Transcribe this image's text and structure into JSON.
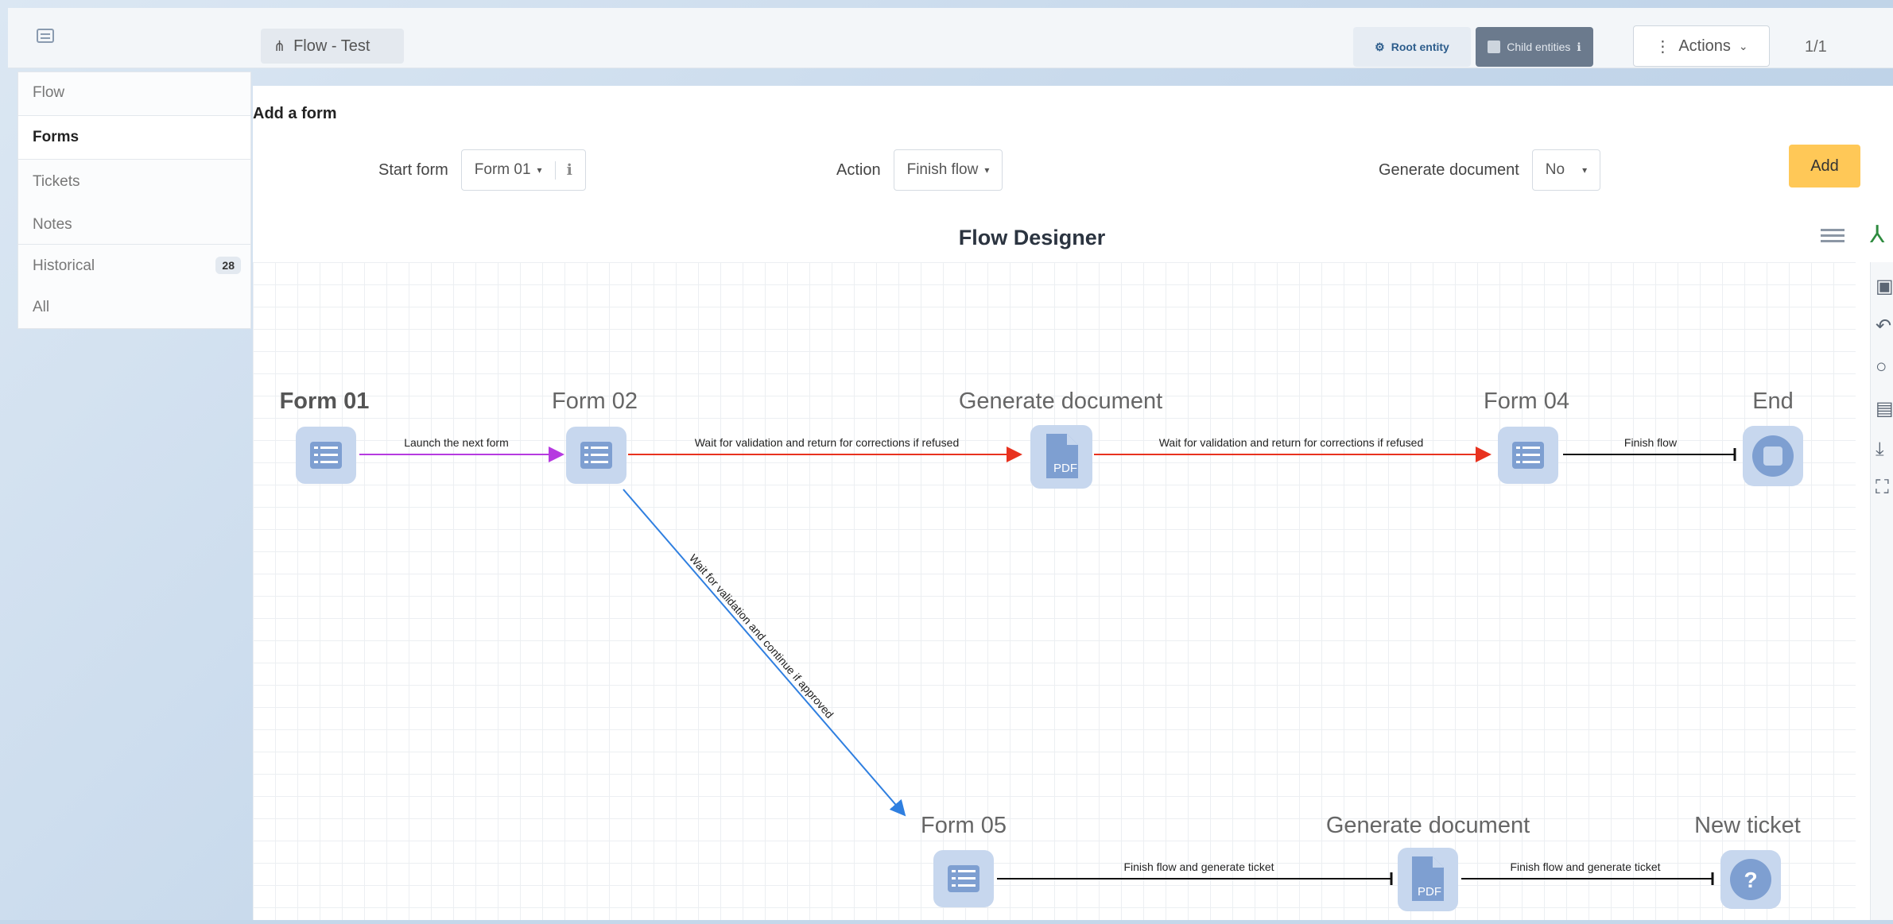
{
  "header": {
    "breadcrumb": "Flow - Test",
    "root_entity_label": "Root entity",
    "child_entities_label": "Child entities",
    "actions_label": "Actions",
    "pager": "1/1"
  },
  "sidebar": {
    "items": [
      {
        "label": "Flow"
      },
      {
        "label": "Forms"
      },
      {
        "label": "Tickets"
      },
      {
        "label": "Notes"
      },
      {
        "label": "Historical",
        "badge": "28"
      },
      {
        "label": "All"
      }
    ]
  },
  "add_form": {
    "title": "Add a form",
    "start_form_label": "Start form",
    "start_form_value": "Form 01",
    "action_label": "Action",
    "action_value": "Finish flow",
    "generate_document_label": "Generate document",
    "generate_document_value": "No",
    "add_button": "Add"
  },
  "designer": {
    "title": "Flow Designer",
    "nodes": {
      "form01": "Form 01",
      "form02": "Form 02",
      "gendoc1": "Generate document",
      "form04": "Form 04",
      "end": "End",
      "form05": "Form 05",
      "gendoc2": "Generate document",
      "newticket": "New ticket"
    },
    "edges": {
      "e1": "Launch the next form",
      "e2": "Wait for validation and return for corrections if refused",
      "e3": "Wait for validation and return for corrections if refused",
      "e4": "Finish flow",
      "e5": "Wait for validation and continue if approved",
      "e6": "Finish flow and generate ticket",
      "e7": "Finish flow and generate ticket"
    },
    "pdf_text": "PDF",
    "question_mark": "?"
  },
  "colors": {
    "launch_edge": "#b63ae0",
    "refused_edge": "#e8321f",
    "approved_edge": "#2f7fe0",
    "finish_edge": "#111111",
    "add_button": "#ffc857",
    "node_fill": "#b9cdea"
  }
}
